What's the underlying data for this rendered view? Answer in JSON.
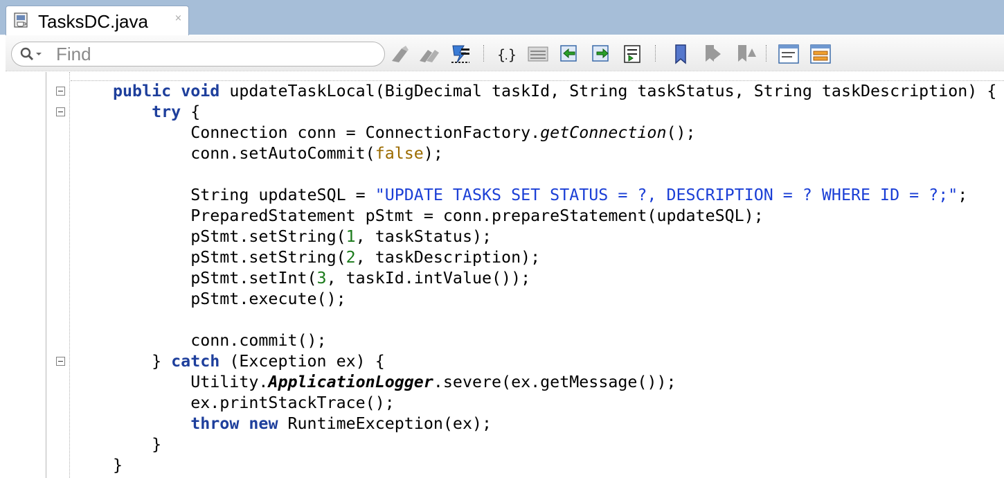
{
  "tab": {
    "title": "TasksDC.java",
    "close": "×"
  },
  "toolbar": {
    "search_placeholder": "Find",
    "buttons": [
      "find-previous",
      "find-next",
      "highlight-occurrences",
      "toggle-brackets",
      "toggle-line-numbers",
      "shift-left",
      "shift-right",
      "import",
      "toggle-bookmark",
      "previous-bookmark",
      "next-bookmark",
      "source-view",
      "split-view"
    ]
  },
  "code": {
    "lines": [
      [
        [
          "kw",
          "public"
        ],
        [
          "p",
          " "
        ],
        [
          "kw",
          "void"
        ],
        [
          "p",
          " updateTaskLocal(BigDecimal taskId, String taskStatus, String taskDescription) {"
        ]
      ],
      [
        [
          "p",
          "    "
        ],
        [
          "kw",
          "try"
        ],
        [
          "p",
          " {"
        ]
      ],
      [
        [
          "p",
          "        Connection conn = ConnectionFactory."
        ],
        [
          "ital",
          "getConnection"
        ],
        [
          "p",
          "();"
        ]
      ],
      [
        [
          "p",
          "        conn.setAutoCommit("
        ],
        [
          "lit",
          "false"
        ],
        [
          "p",
          ");"
        ]
      ],
      [
        [
          "p",
          ""
        ]
      ],
      [
        [
          "p",
          "        String updateSQL = "
        ],
        [
          "str",
          "\"UPDATE TASKS SET STATUS = ?, DESCRIPTION = ? WHERE ID = ?;\""
        ],
        [
          "p",
          ";"
        ]
      ],
      [
        [
          "p",
          "        PreparedStatement pStmt = conn.prepareStatement(updateSQL);"
        ]
      ],
      [
        [
          "p",
          "        pStmt.setString("
        ],
        [
          "num",
          "1"
        ],
        [
          "p",
          ", taskStatus);"
        ]
      ],
      [
        [
          "p",
          "        pStmt.setString("
        ],
        [
          "num",
          "2"
        ],
        [
          "p",
          ", taskDescription);"
        ]
      ],
      [
        [
          "p",
          "        pStmt.setInt("
        ],
        [
          "num",
          "3"
        ],
        [
          "p",
          ", taskId.intValue());"
        ]
      ],
      [
        [
          "p",
          "        pStmt.execute();"
        ]
      ],
      [
        [
          "p",
          ""
        ]
      ],
      [
        [
          "p",
          "        conn.commit();"
        ]
      ],
      [
        [
          "p",
          "    } "
        ],
        [
          "kw",
          "catch"
        ],
        [
          "p",
          " (Exception ex) {"
        ]
      ],
      [
        [
          "p",
          "        Utility."
        ],
        [
          "bi",
          "ApplicationLogger"
        ],
        [
          "p",
          ".severe(ex.getMessage());"
        ]
      ],
      [
        [
          "p",
          "        ex.printStackTrace();"
        ]
      ],
      [
        [
          "p",
          "        "
        ],
        [
          "kw",
          "throw"
        ],
        [
          "p",
          " "
        ],
        [
          "kw",
          "new"
        ],
        [
          "p",
          " RuntimeException(ex);"
        ]
      ],
      [
        [
          "p",
          "    }"
        ]
      ],
      [
        [
          "p",
          "}"
        ]
      ]
    ]
  },
  "folds": [
    0,
    1,
    13
  ]
}
